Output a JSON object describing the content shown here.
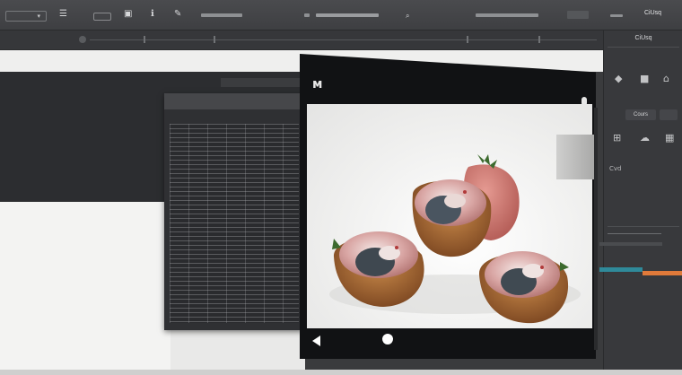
{
  "toolbar": {
    "icons": [
      "dropdown-caret",
      "document-icon",
      "layers-icon",
      "info-icon",
      "mail-icon",
      "settings-icon"
    ],
    "buttons": [
      "",
      ""
    ],
    "label_right": "CiUsq"
  },
  "inspector": {
    "title": "CiUsq",
    "tab_left": "Cours",
    "tab_right": "",
    "rows": [
      "Cvd"
    ]
  },
  "colors": {
    "background": "#3a3b3d",
    "accent_teal": "#2f8a9a",
    "accent_orange": "#e07a3a",
    "frame": "#111214"
  },
  "frame": {
    "logo_icon": "brand-logo-icon",
    "nav": [
      "back-icon",
      "home-icon"
    ]
  }
}
